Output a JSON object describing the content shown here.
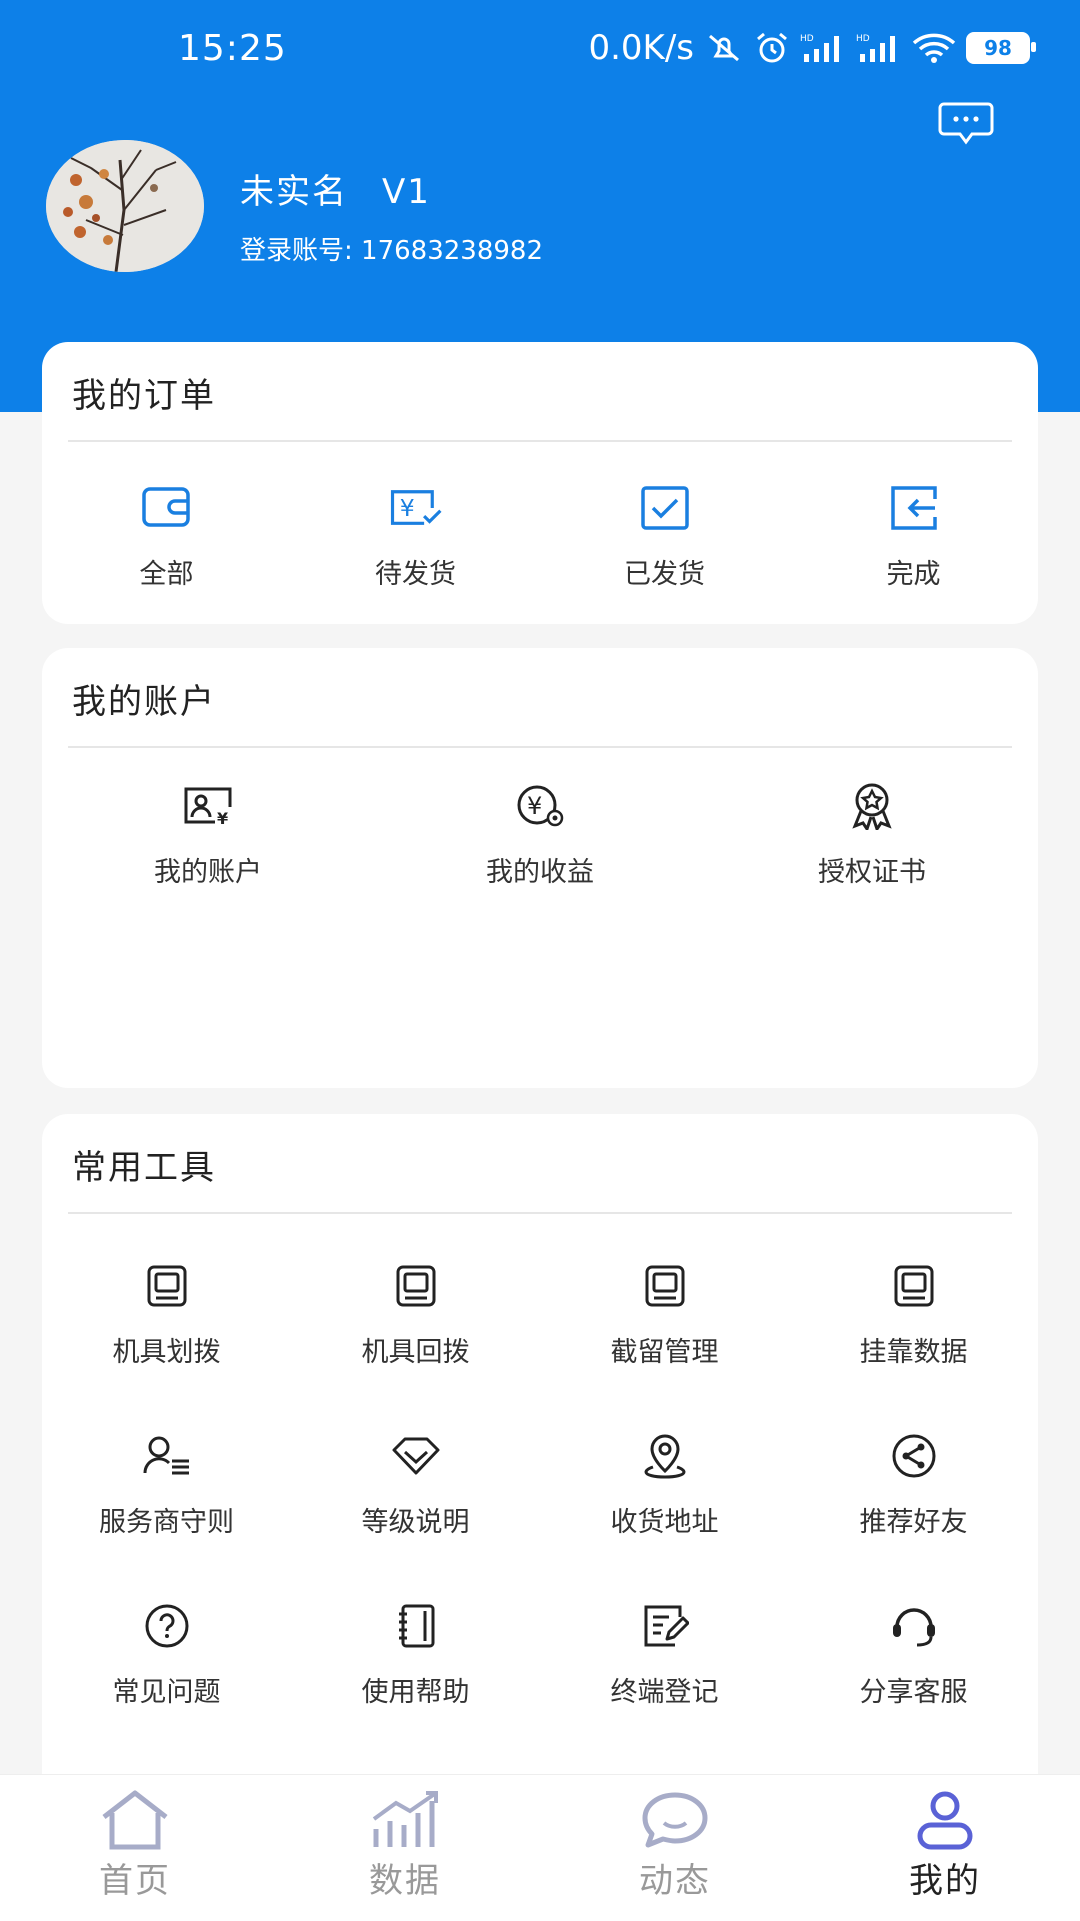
{
  "status_bar": {
    "time": "15:25",
    "net_speed": "0.0K/s",
    "battery": "98"
  },
  "profile": {
    "name": "未实名",
    "level": "V1",
    "account_label": "登录账号:",
    "account_number": "17683238982"
  },
  "orders": {
    "title": "我的订单",
    "items": [
      {
        "label": "全部",
        "icon": "wallet-icon"
      },
      {
        "label": "待发货",
        "icon": "yuan-pending-icon"
      },
      {
        "label": "已发货",
        "icon": "checked-box-icon"
      },
      {
        "label": "完成",
        "icon": "return-box-icon"
      }
    ]
  },
  "account": {
    "title": "我的账户",
    "items": [
      {
        "label": "我的账户",
        "icon": "id-card-yuan-icon"
      },
      {
        "label": "我的收益",
        "icon": "yuan-coin-icon"
      },
      {
        "label": "授权证书",
        "icon": "award-badge-icon"
      }
    ]
  },
  "tools": {
    "title": "常用工具",
    "items": [
      {
        "label": "机具划拨",
        "icon": "terminal-icon"
      },
      {
        "label": "机具回拨",
        "icon": "terminal-icon"
      },
      {
        "label": "截留管理",
        "icon": "terminal-icon"
      },
      {
        "label": "挂靠数据",
        "icon": "terminal-icon"
      },
      {
        "label": "服务商守则",
        "icon": "user-rules-icon"
      },
      {
        "label": "等级说明",
        "icon": "diamond-icon"
      },
      {
        "label": "收货地址",
        "icon": "location-pin-icon"
      },
      {
        "label": "推荐好友",
        "icon": "share-icon"
      },
      {
        "label": "常见问题",
        "icon": "question-icon"
      },
      {
        "label": "使用帮助",
        "icon": "notebook-icon"
      },
      {
        "label": "终端登记",
        "icon": "edit-form-icon"
      },
      {
        "label": "分享客服",
        "icon": "headset-icon"
      }
    ]
  },
  "tabbar": {
    "items": [
      {
        "label": "首页",
        "icon": "home-icon"
      },
      {
        "label": "数据",
        "icon": "chart-icon"
      },
      {
        "label": "动态",
        "icon": "chat-bubble-icon"
      },
      {
        "label": "我的",
        "icon": "user-icon"
      }
    ],
    "active": "我的"
  },
  "colors": {
    "brand_blue": "#0d80e8",
    "icon_blue": "#1a7fe0",
    "active_tab": "#5a62d6",
    "inactive_tab": "#a7acc8"
  }
}
